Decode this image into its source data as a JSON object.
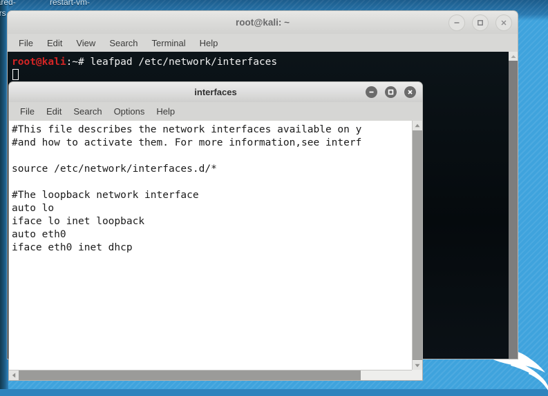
{
  "desktop": {
    "background_color": "#3fa3dd",
    "icon_labels": [
      "hared-",
      "restart-vm-",
      "ers",
      ". ."
    ],
    "logo_name": "kali-dragon-logo"
  },
  "terminal": {
    "title": "root@kali: ~",
    "menu": [
      "File",
      "Edit",
      "View",
      "Search",
      "Terminal",
      "Help"
    ],
    "window_buttons": [
      "minimize",
      "maximize",
      "close"
    ],
    "prompt_user": "root@kali",
    "prompt_suffix": ":~# ",
    "command": "leafpad /etc/network/interfaces",
    "prompt_color": "#d42525",
    "background_color": "#0b1014",
    "text_color": "#e6e6e6"
  },
  "leafpad": {
    "title": "interfaces",
    "menu": [
      "File",
      "Edit",
      "Search",
      "Options",
      "Help"
    ],
    "window_buttons": [
      "minimize",
      "maximize",
      "close"
    ],
    "content": "#This file describes the network interfaces available on y\n#and how to activate them. For more information,see interf\n\nsource /etc/network/interfaces.d/*\n\n#The loopback network interface\nauto lo\niface lo inet loopback\nauto eth0\niface eth0 inet dhcp",
    "background_color": "#ffffff",
    "text_color": "#1a1a1a"
  }
}
